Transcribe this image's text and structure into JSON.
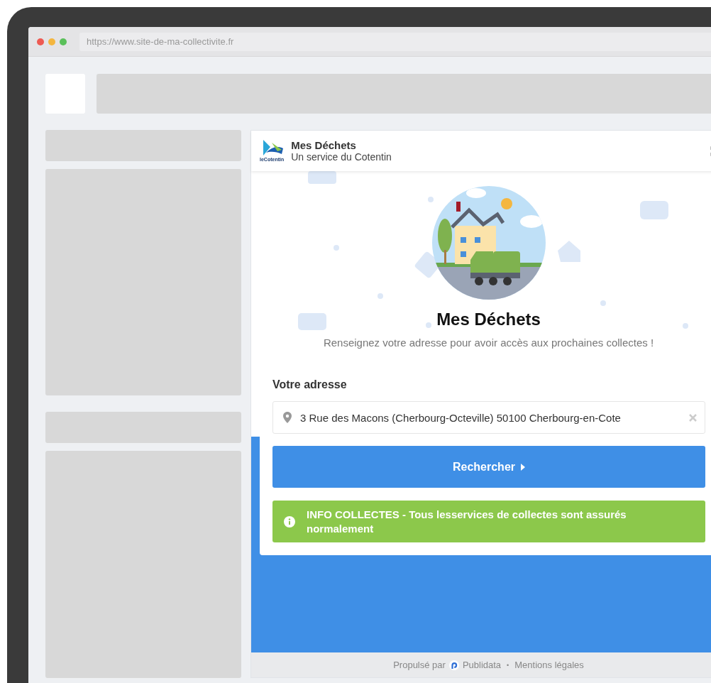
{
  "browser": {
    "traffic_lights": [
      {
        "color": "#ee5a52"
      },
      {
        "color": "#f4b63f"
      },
      {
        "color": "#5ac05a"
      }
    ],
    "url": "https://www.site-de-ma-collectivite.fr"
  },
  "widget": {
    "logo_text": "leCotentin",
    "title": "Mes Déchets",
    "subtitle": "Un service du Cotentin",
    "hero_title": "Mes Déchets",
    "hero_text": "Renseignez votre adresse pour avoir accès aux prochaines collectes !",
    "address_label": "Votre adresse",
    "address_value": "3 Rue des Macons (Cherbourg-Octeville) 50100 Cherbourg-en-Cote",
    "search_button": "Rechercher",
    "info": "INFO COLLECTES - Tous lesservices de collectes sont assurés normalement",
    "footer": {
      "powered_by": "Propulsé par",
      "brand": "Publidata",
      "separator": "•",
      "legal": "Mentions légales"
    }
  }
}
